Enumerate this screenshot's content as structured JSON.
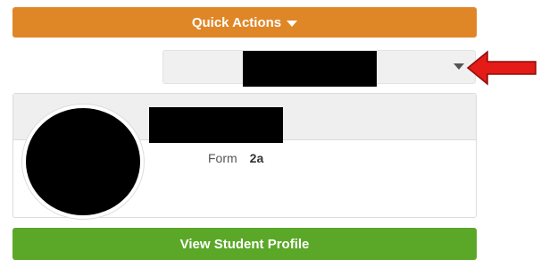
{
  "quick_actions": {
    "label": "Quick Actions",
    "icon": "caret-down-icon",
    "color": "#df8627"
  },
  "student_selector": {
    "icon": "caret-down-icon",
    "annotation_arrow_color": "#e41b17"
  },
  "student_card": {
    "form_label": "Form",
    "form_value": "2a"
  },
  "view_profile": {
    "label": "View Student Profile",
    "color": "#5ba828"
  }
}
